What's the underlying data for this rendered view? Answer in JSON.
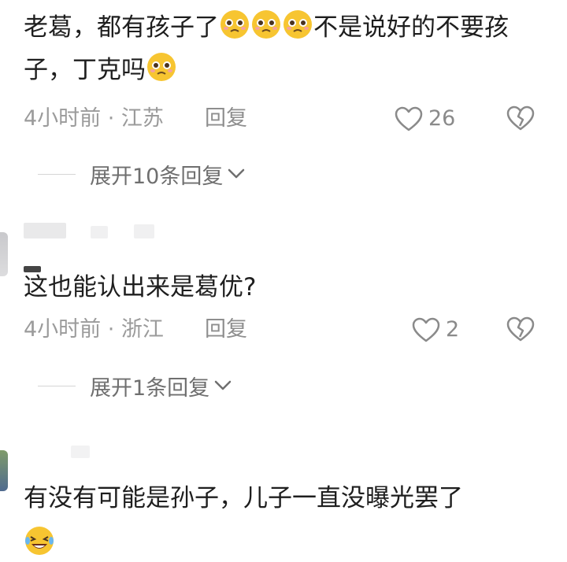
{
  "comments": [
    {
      "text_part1": "老葛，都有孩子了",
      "text_part2": "不是说好的不要孩子，丁克吗",
      "emoji_icons": [
        "pleading-face-icon",
        "pleading-face-icon",
        "pleading-face-icon",
        "pleading-face-icon"
      ],
      "time_location": "4小时前 · 江苏",
      "reply_label": "回复",
      "likes": "26",
      "expand_label": "展开10条回复"
    },
    {
      "text": "这也能认出来是葛优?",
      "time_location": "4小时前 · 浙江",
      "reply_label": "回复",
      "likes": "2",
      "expand_label": "展开1条回复"
    },
    {
      "text": "有没有可能是孙子，儿子一直没曝光罢了",
      "emoji_icons": [
        "laughing-tears-icon"
      ]
    }
  ],
  "colors": {
    "text": "#1e1e1e",
    "meta": "#9b9b9b",
    "emoji": "#f7c531"
  }
}
